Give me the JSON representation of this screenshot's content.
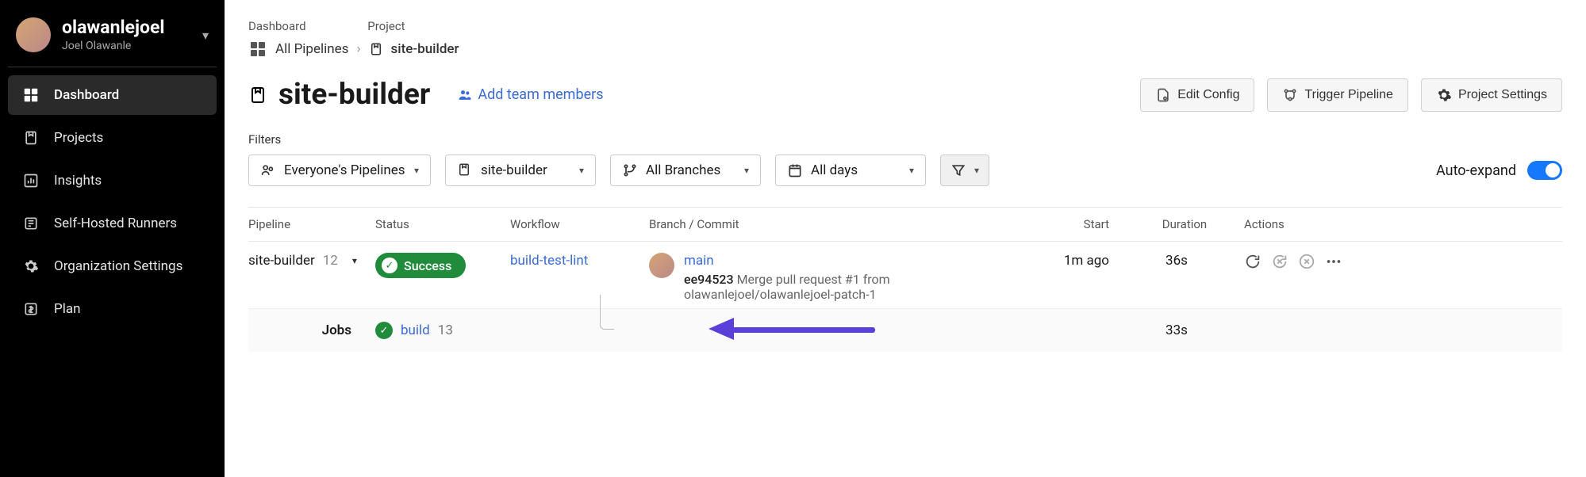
{
  "user": {
    "handle": "olawanlejoel",
    "name": "Joel Olawanle"
  },
  "nav": [
    {
      "label": "Dashboard",
      "active": true,
      "icon": "grid"
    },
    {
      "label": "Projects",
      "active": false,
      "icon": "bookmark"
    },
    {
      "label": "Insights",
      "active": false,
      "icon": "chart"
    },
    {
      "label": "Self-Hosted Runners",
      "active": false,
      "icon": "server"
    },
    {
      "label": "Organization Settings",
      "active": false,
      "icon": "gear"
    },
    {
      "label": "Plan",
      "active": false,
      "icon": "dollar"
    }
  ],
  "breadcrumbs": {
    "dashboard": "Dashboard",
    "project": "Project",
    "allPipelines": "All Pipelines",
    "projectName": "site-builder"
  },
  "title": "site-builder",
  "addMembers": "Add team members",
  "headerButtons": {
    "editConfig": "Edit Config",
    "triggerPipeline": "Trigger Pipeline",
    "projectSettings": "Project Settings"
  },
  "filtersLabel": "Filters",
  "filters": {
    "pipelines": "Everyone's Pipelines",
    "project": "site-builder",
    "branches": "All Branches",
    "days": "All days"
  },
  "autoExpandLabel": "Auto-expand",
  "autoExpand": true,
  "columns": {
    "pipeline": "Pipeline",
    "status": "Status",
    "workflow": "Workflow",
    "branch": "Branch / Commit",
    "start": "Start",
    "duration": "Duration",
    "actions": "Actions"
  },
  "row": {
    "name": "site-builder",
    "number": "12",
    "status": "Success",
    "workflow": "build-test-lint",
    "branch": "main",
    "commitHash": "ee94523",
    "commitMsg": "Merge pull request #1 from olawanlejoel/olawanlejoel-patch-1",
    "start": "1m ago",
    "duration": "36s"
  },
  "jobsLabel": "Jobs",
  "job": {
    "name": "build",
    "number": "13",
    "duration": "33s"
  }
}
